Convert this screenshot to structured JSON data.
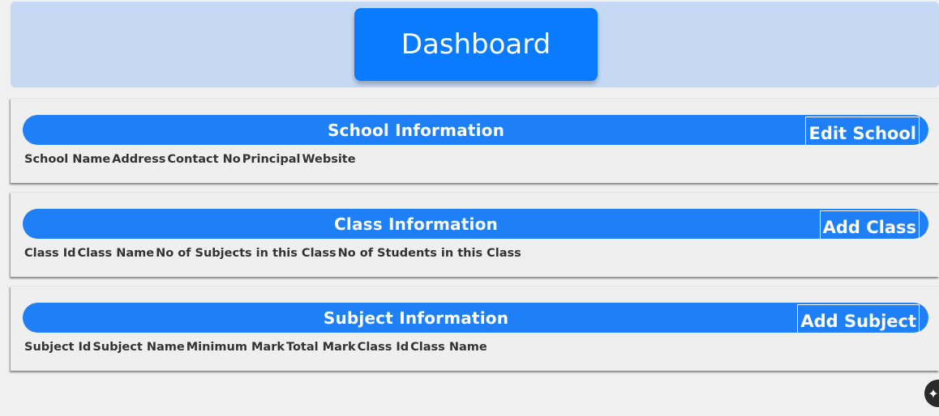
{
  "header": {
    "title": "Dashboard"
  },
  "sections": {
    "school": {
      "title": "School Information",
      "action": "Edit School",
      "columns": [
        "School Name",
        "Address",
        "Contact No",
        "Principal",
        "Website"
      ]
    },
    "class": {
      "title": "Class Information",
      "action": "Add Class",
      "columns": [
        "Class Id",
        "Class Name",
        "No of Subjects in this Class",
        "No of Students in this Class"
      ]
    },
    "subject": {
      "title": "Subject Information",
      "action": "Add Subject",
      "columns": [
        "Subject Id",
        "Subject Name",
        "Minimum Mark",
        "Total Mark",
        "Class Id",
        "Class Name"
      ]
    }
  },
  "fab": {
    "icon": "sparkle-icon",
    "glyph": "✦"
  },
  "colors": {
    "accent": "#0a7bff",
    "bar": "#1e7ff7",
    "header_bg": "#c5d9f4",
    "page_bg": "#f0f0f0"
  }
}
